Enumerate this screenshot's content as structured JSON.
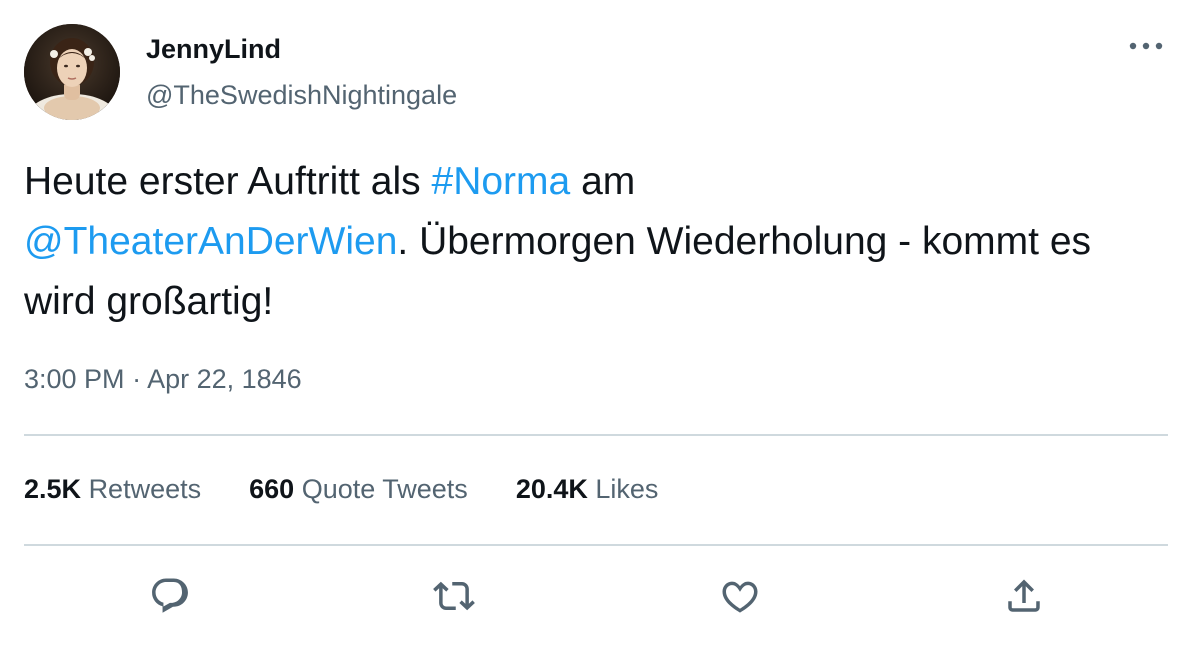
{
  "tweet": {
    "display_name": "JennyLind",
    "handle": "@TheSwedishNightingale",
    "text_parts": {
      "p1": "Heute erster Auftritt als ",
      "hashtag": "#Norma",
      "p2": " am",
      "mention": "@TheaterAnDerWien",
      "p3": ". Übermorgen Wiederholung - kommt es wird großartig!"
    },
    "time": "3:00 PM",
    "separator": " · ",
    "date": "Apr 22, 1846"
  },
  "stats": {
    "retweets_count": "2.5K",
    "retweets_label": "Retweets",
    "quotes_count": "660",
    "quotes_label": "Quote Tweets",
    "likes_count": "20.4K",
    "likes_label": "Likes"
  },
  "actions": [
    "reply-icon",
    "retweet-icon",
    "like-icon",
    "share-icon"
  ],
  "colors": {
    "link": "#1d9bf0",
    "secondary_text": "#536471",
    "primary_text": "#0f1419",
    "divider": "#cfd9de"
  }
}
